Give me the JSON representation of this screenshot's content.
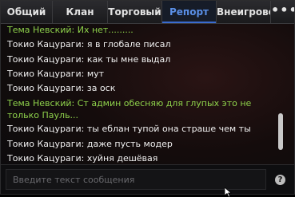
{
  "tabs": [
    {
      "label": "Общий"
    },
    {
      "label": "Клан"
    },
    {
      "label": "Торговый"
    },
    {
      "label": "Репорт"
    },
    {
      "label": "Внеигровой"
    }
  ],
  "tabs_more_label": "•••",
  "active_tab": "Репорт",
  "messages": [
    {
      "text": "Тема Невский: Их нет.........",
      "color": "#8ed14b"
    },
    {
      "text": "Токио Кацураги: я в глобале писал",
      "color": "#f0f0f0"
    },
    {
      "text": "Токио Кацураги: как ты мне выдал",
      "color": "#f0f0f0"
    },
    {
      "text": "Токио Кацураги: мут",
      "color": "#f0f0f0"
    },
    {
      "text": "Токио Кацураги: за оск",
      "color": "#f0f0f0"
    },
    {
      "text": "Тема Невский: Ст админ обесняю для глупых это не только Пауль...",
      "color": "#8ed14b"
    },
    {
      "text": "Токио Кацураги: ты еблан тупой она страше чем ты",
      "color": "#f0f0f0"
    },
    {
      "text": "Токио Кацураги: даже пусть модер",
      "color": "#f0f0f0"
    },
    {
      "text": "Токио Кацураги: хуйня дешёвая",
      "color": "#f0f0f0"
    }
  ],
  "input": {
    "placeholder": "Введите текст сообщения",
    "value": ""
  },
  "help_label": "?",
  "colors": {
    "system_green": "#8ed14b",
    "active_tab_text": "#5a8fe6",
    "text": "#f0f0f0"
  }
}
